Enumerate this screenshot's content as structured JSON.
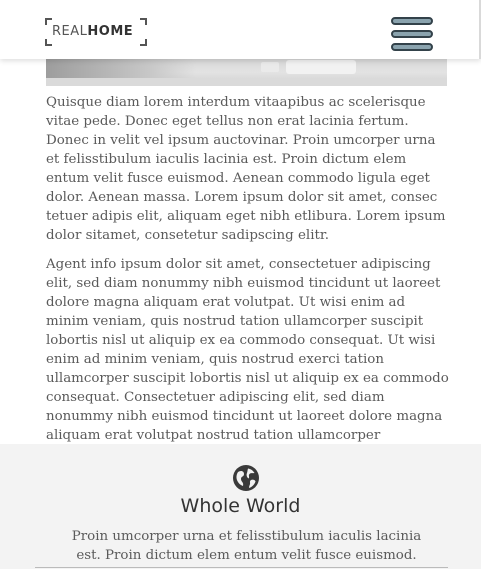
{
  "header": {
    "logo": {
      "light": "REAL",
      "bold": "HOME"
    },
    "menu_icon": "hamburger-icon"
  },
  "hero": {
    "image": "photo-banner"
  },
  "content": {
    "paragraph1": "Quisque diam lorem interdum vitaapibus ac scelerisque vitae pede. Donec eget tellus non erat lacinia fertum. Donec in velit vel ipsum auctovinar. Proin umcorper urna et felisstibulum iaculis lacinia est. Proin dictum elem entum velit fusce euismod. Aenean commodo ligula eget dolor. Aenean massa. Lorem ipsum dolor sit amet, consec tetuer adipis elit, aliquam eget nibh etlibura. Lorem ipsum dolor sitamet, consetetur sadipscing elitr.",
    "paragraph2": "Agent info ipsum dolor sit amet, consectetuer adipiscing elit, sed diam nonummy nibh euismod tincidunt ut laoreet dolore magna aliquam erat volutpat. Ut wisi enim ad minim veniam, quis nostrud tation ullamcorper suscipit lobortis nisl ut aliquip ex ea commodo consequat. Ut wisi enim ad minim veniam, quis nostrud exerci tation ullamcorper suscipit lobortis nisl ut aliquip ex ea commodo consequat. Consectetuer adipiscing elit, sed diam nonummy nibh euismod tincidunt ut laoreet dolore magna aliquam erat volutpat nostrud tation ullamcorper nonummy nibh."
  },
  "feature": {
    "icon": "globe-icon",
    "title": "Whole World",
    "text": "Proin umcorper urna et felisstibulum iaculis lacinia est. Proin dictum elem entum velit fusce euismod."
  },
  "colors": {
    "menu_fill": "#8aa3ae",
    "menu_stroke": "#33424a",
    "feature_bg": "#f3f3f3",
    "text": "#5a5a5a"
  }
}
